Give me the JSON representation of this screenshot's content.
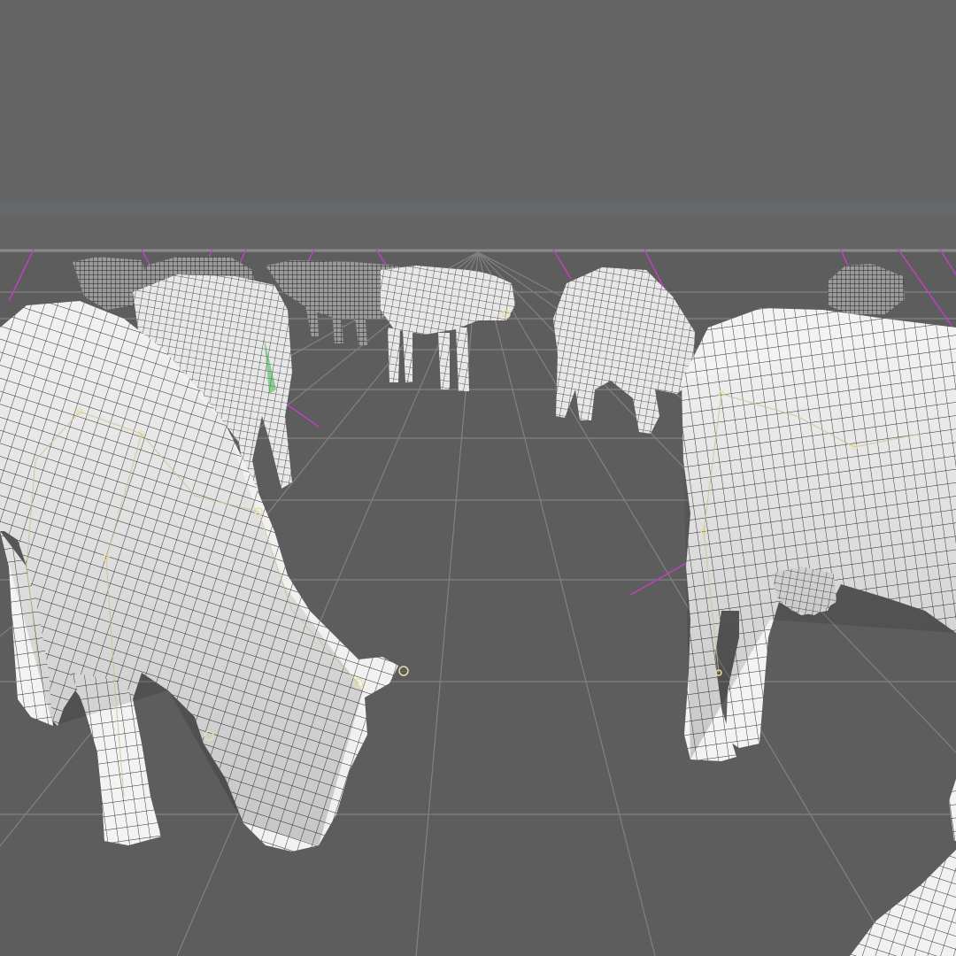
{
  "viewport": {
    "description_name": "3d-viewport",
    "colors": {
      "sky": "#646464",
      "floor": "#5c5c5c",
      "grid_line": "#8a8a8a",
      "horizon_band": "#7a7a7a",
      "mesh_fill": "#f2f2f2",
      "mesh_fill_shadow": "#cfcfcf",
      "wire": "#2a2a2a",
      "far_mesh": "#3a3a3a",
      "rig_joint": "#e8e0a0",
      "rig_bone": "#c8c090",
      "selection_line": "#c040c0",
      "accent_green": "#30b040"
    },
    "objects": [
      {
        "name": "cow-grazing-left",
        "kind": "mesh",
        "wireframe": true,
        "rig_visible": true
      },
      {
        "name": "cow-standing-right",
        "kind": "mesh",
        "wireframe": true,
        "rig_visible": true
      },
      {
        "name": "cow-back-left-1",
        "kind": "mesh",
        "wireframe": true,
        "rig_visible": true
      },
      {
        "name": "cow-back-left-2",
        "kind": "mesh",
        "wireframe": true,
        "rig_visible": true
      },
      {
        "name": "cow-back-center",
        "kind": "mesh",
        "wireframe": true,
        "rig_visible": true
      },
      {
        "name": "cow-back-mid",
        "kind": "mesh",
        "wireframe": true,
        "rig_visible": true
      },
      {
        "name": "cow-back-right",
        "kind": "mesh",
        "wireframe": true,
        "rig_visible": true
      },
      {
        "name": "cow-corner-bottom-right",
        "kind": "mesh",
        "wireframe": true,
        "rig_visible": false
      }
    ]
  }
}
